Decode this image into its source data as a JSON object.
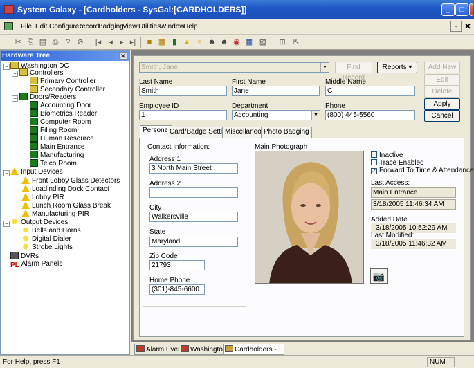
{
  "app": {
    "title": "System Galaxy - [Cardholders - SysGal:[CARDHOLDERS]]"
  },
  "menu": [
    {
      "label": "File"
    },
    {
      "label": "Edit"
    },
    {
      "label": "Configure"
    },
    {
      "label": "Record"
    },
    {
      "label": "Badging"
    },
    {
      "label": "View"
    },
    {
      "label": "Utilities"
    },
    {
      "label": "Window"
    },
    {
      "label": "Help"
    }
  ],
  "tree": {
    "header": "Hardware Tree",
    "nodes": [
      {
        "label": "Washington DC"
      },
      {
        "label": "Controllers"
      },
      {
        "label": "Primary Controller"
      },
      {
        "label": "Secondary Controller"
      },
      {
        "label": "Doors/Readers"
      },
      {
        "label": "Accounting Door"
      },
      {
        "label": "Biometrics Reader"
      },
      {
        "label": "Computer Room"
      },
      {
        "label": "Filing Room"
      },
      {
        "label": "Human Resource"
      },
      {
        "label": "Main Entrance"
      },
      {
        "label": "Manufacturing"
      },
      {
        "label": "Telco Room"
      },
      {
        "label": "Input Devices"
      },
      {
        "label": "Front Lobby Glass Detectors"
      },
      {
        "label": "Loadinding Dock Contact"
      },
      {
        "label": "Lobby PIR"
      },
      {
        "label": "Lunch Room Glass Break"
      },
      {
        "label": "Manufacturing PIR"
      },
      {
        "label": "Output Devices"
      },
      {
        "label": "Bells and Horns"
      },
      {
        "label": "Digital Dialer"
      },
      {
        "label": "Strobe Lights"
      },
      {
        "label": "DVRs"
      },
      {
        "label": "Alarm Panels"
      }
    ]
  },
  "form": {
    "search_value": "Smith, Jane",
    "find_record": "Find Record",
    "reports": "Reports",
    "add_new": "Add New",
    "edit": "Edit",
    "delete": "Delete",
    "apply": "Apply",
    "cancel": "Cancel",
    "last_name_label": "Last Name",
    "last_name": "Smith",
    "first_name_label": "First Name",
    "first_name": "Jane",
    "middle_name_label": "Middle Name",
    "middle_name": "C",
    "employee_id_label": "Employee ID",
    "employee_id": "1",
    "department_label": "Department",
    "department": "Accounting",
    "phone_label": "Phone",
    "phone": "(800) 445-5560"
  },
  "tabs": [
    {
      "label": "Personal"
    },
    {
      "label": "Card/Badge Settings"
    },
    {
      "label": "Miscellaneous"
    },
    {
      "label": "Photo Badging"
    }
  ],
  "personal": {
    "contact_info": "Contact Information:",
    "address1_label": "Address 1",
    "address1": "3 North Main Street",
    "address2_label": "Address 2",
    "address2": "",
    "city_label": "City",
    "city": "Walkersville",
    "state_label": "State",
    "state": "Maryland",
    "zip_label": "Zip Code",
    "zip": "21793",
    "home_phone_label": "Home Phone",
    "home_phone": "(301)-845-6600",
    "main_photo": "Main Photograph",
    "inactive": "Inactive",
    "trace_enabled": "Trace Enabled",
    "forward": "Forward To Time & Attendance",
    "last_access_label": "Last Access:",
    "last_access": "Main Entrance",
    "last_access_time": "3/18/2005 11:46:34 AM",
    "added_date_label": "Added Date",
    "added_date": "3/18/2005 10:52:29 AM",
    "last_modified_label": "Last Modified:",
    "last_modified": "3/18/2005 11:46:32 AM"
  },
  "window_tabs": [
    {
      "label": "Alarm Events"
    },
    {
      "label": "Washingto..."
    },
    {
      "label": "Cardholders -..."
    }
  ],
  "status": {
    "help": "For Help, press F1",
    "num": "NUM"
  },
  "colors": {
    "titlebar": "#2058c8",
    "tree_header": "#2d63d6"
  }
}
